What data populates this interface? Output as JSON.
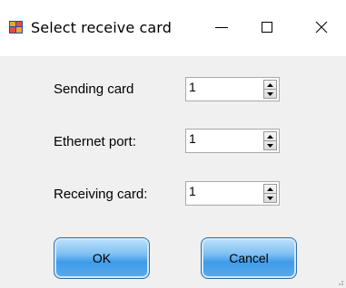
{
  "window": {
    "title": "Select receive card",
    "controls": {
      "minimize_icon": "minimize-icon",
      "maximize_icon": "maximize-icon",
      "close_icon": "close-icon"
    }
  },
  "fields": [
    {
      "label": "Sending card",
      "value": "1"
    },
    {
      "label": "Ethernet port:",
      "value": "1"
    },
    {
      "label": "Receiving card:",
      "value": "1"
    }
  ],
  "buttons": {
    "ok_label": "OK",
    "cancel_label": "Cancel"
  },
  "colors": {
    "button_blue": "#3f9be9",
    "window_bg": "#f0f0f0"
  }
}
